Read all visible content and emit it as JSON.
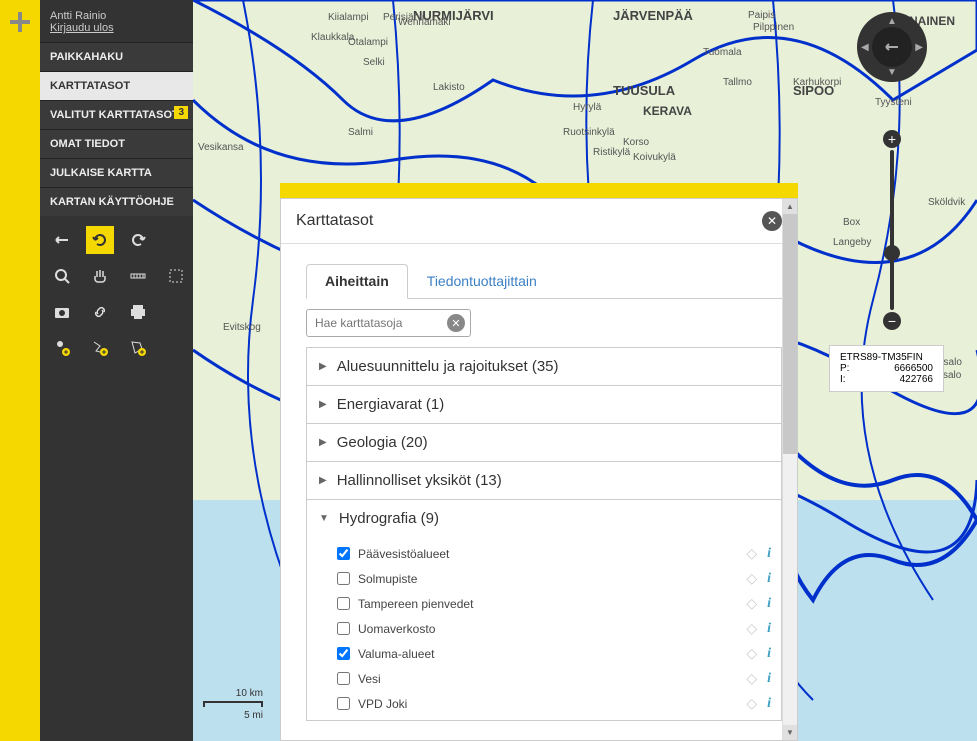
{
  "user": {
    "name": "Antti Rainio",
    "logout": "Kirjaudu ulos"
  },
  "menu": {
    "paikkahaku": "PAIKKAHAKU",
    "karttatasot": "KARTTATASOT",
    "valitut": "VALITUT KARTTATASOT",
    "valitut_badge": "3",
    "omat": "OMAT TIEDOT",
    "julkaise": "JULKAISE KARTTA",
    "ohje": "KARTAN KÄYTTÖOHJE"
  },
  "coords": {
    "system": "ETRS89-TM35FIN",
    "p_label": "P:",
    "p_value": "6666500",
    "i_label": "I:",
    "i_value": "422766"
  },
  "scale": {
    "top": "10 km",
    "bottom": "5 mi"
  },
  "dialog": {
    "title": "Karttatasot",
    "tabs": {
      "theme": "Aiheittain",
      "provider": "Tiedontuottajittain"
    },
    "search_placeholder": "Hae karttatasoja",
    "categories": [
      {
        "label": "Aluesuunnittelu ja rajoitukset (35)",
        "expanded": false
      },
      {
        "label": "Energiavarat (1)",
        "expanded": false
      },
      {
        "label": "Geologia (20)",
        "expanded": false
      },
      {
        "label": "Hallinnolliset yksiköt (13)",
        "expanded": false
      },
      {
        "label": "Hydrografia (9)",
        "expanded": true,
        "layers": [
          {
            "label": "Päävesistöalueet",
            "checked": true
          },
          {
            "label": "Solmupiste",
            "checked": false
          },
          {
            "label": "Tampereen pienvedet",
            "checked": false
          },
          {
            "label": "Uomaverkosto",
            "checked": false
          },
          {
            "label": "Valuma-alueet",
            "checked": true
          },
          {
            "label": "Vesi",
            "checked": false
          },
          {
            "label": "VPD Joki",
            "checked": false
          }
        ]
      }
    ]
  },
  "map_labels": [
    "NURMIJÄRVI",
    "JÄRVENPÄÄ",
    "TUUSULA",
    "KERAVA",
    "SIPOO",
    "PORNAINEN",
    "Vesikansa",
    "Otalampi",
    "Salmi",
    "Evitskog",
    "Hyrylä",
    "Ruotsinkylä",
    "Ristikylä",
    "Korso",
    "Koivukylä",
    "Tallmo",
    "Paipis",
    "Pilppinen",
    "Box",
    "Langeby",
    "Kiialampi",
    "Klaukkala",
    "Selki",
    "Perisjärvi",
    "Tuomala",
    "Lakisto",
    "Wennamäki",
    "Emäsalo",
    "Emsalo",
    "Sköldvik",
    "Karhukorpi",
    "Tyysteni"
  ]
}
